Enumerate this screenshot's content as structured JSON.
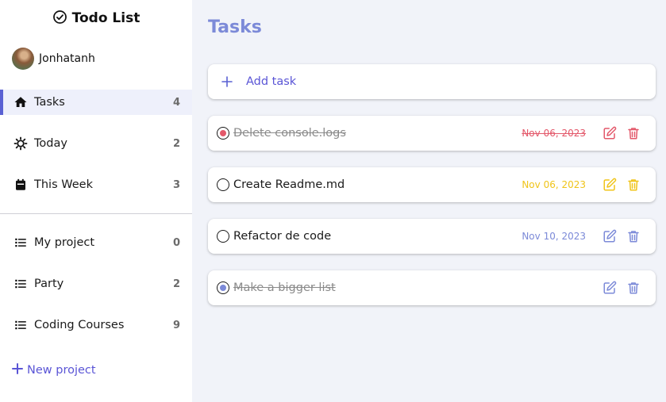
{
  "brand": {
    "title": "Todo List"
  },
  "user": {
    "name": "Jonhatanh"
  },
  "nav": {
    "tasks": {
      "label": "Tasks",
      "count": "4"
    },
    "today": {
      "label": "Today",
      "count": "2"
    },
    "week": {
      "label": "This Week",
      "count": "3"
    }
  },
  "projects": [
    {
      "label": "My project",
      "count": "0"
    },
    {
      "label": "Party",
      "count": "2"
    },
    {
      "label": "Coding Courses",
      "count": "9"
    }
  ],
  "new_project": "New project",
  "main": {
    "title": "Tasks",
    "add_task": "Add task",
    "tasks": [
      {
        "title": "Delete console.logs",
        "date": "Nov 06, 2023",
        "done": true,
        "color": "#e3586a"
      },
      {
        "title": "Create Readme.md",
        "date": "Nov 06, 2023",
        "done": false,
        "color": "#f0c419"
      },
      {
        "title": "Refactor de code",
        "date": "Nov 10, 2023",
        "done": false,
        "color": "#7c8ad8"
      },
      {
        "title": "Make a bigger list",
        "date": "",
        "done": true,
        "color": "#7c8ad8"
      }
    ]
  },
  "colors": {
    "accent": "#5a61d3",
    "title": "#7c8ad8",
    "sidebar_active": "#eef0fb",
    "background": "#f1f3f9"
  },
  "icons": {
    "brand": "check-circle-icon",
    "tasks": "home-icon",
    "today": "sun-icon",
    "week": "calendar-icon",
    "project": "list-icon",
    "edit": "edit-icon",
    "delete": "trash-icon"
  }
}
